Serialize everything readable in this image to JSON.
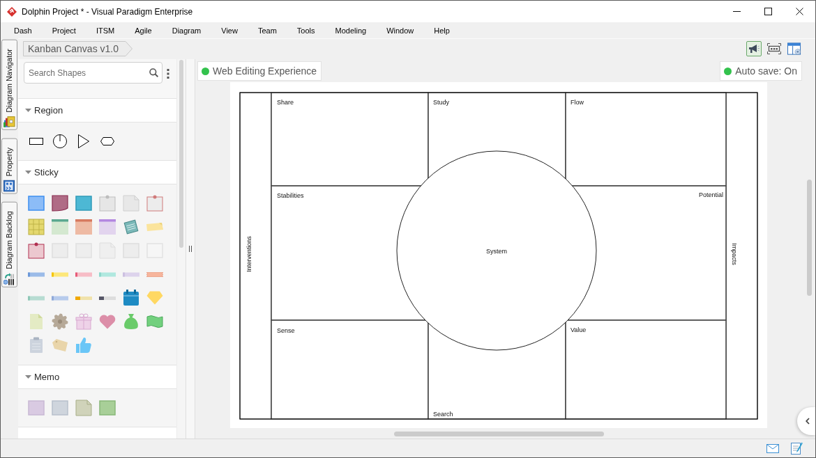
{
  "window": {
    "title": "Dolphin Project * - Visual Paradigm Enterprise"
  },
  "menu": [
    "Dash",
    "Project",
    "ITSM",
    "Agile",
    "Diagram",
    "View",
    "Team",
    "Tools",
    "Modeling",
    "Window",
    "Help"
  ],
  "side_tabs": [
    {
      "label": "Diagram Navigator",
      "kind": "navigator",
      "selected": false
    },
    {
      "label": "Property",
      "kind": "property",
      "selected": false
    },
    {
      "label": "Diagram Backlog",
      "kind": "backlog",
      "selected": false
    }
  ],
  "breadcrumb": "Kanban Canvas v1.0",
  "toolbar": [
    {
      "kind": "megaphone",
      "on": true
    },
    {
      "kind": "fit",
      "on": false
    },
    {
      "kind": "panel",
      "on": false
    }
  ],
  "palette": {
    "search": {
      "placeholder": "Search Shapes"
    },
    "sections": [
      {
        "title": "Region",
        "expanded": true
      },
      {
        "title": "Sticky",
        "expanded": true
      },
      {
        "title": "Memo",
        "expanded": true
      }
    ]
  },
  "canvas": {
    "badges": [
      {
        "label": "Web Editing Experience",
        "color": "#33c24d"
      },
      {
        "label": "Auto save: On",
        "color": "#33c24d"
      }
    ],
    "diagram": {
      "left_lane": "Interventions",
      "right_lane": "Impacts",
      "regions": [
        "Share",
        "Study",
        "Flow",
        "Stabilities",
        "Potential",
        "Sense",
        "Search",
        "Value"
      ],
      "center": "System"
    }
  }
}
